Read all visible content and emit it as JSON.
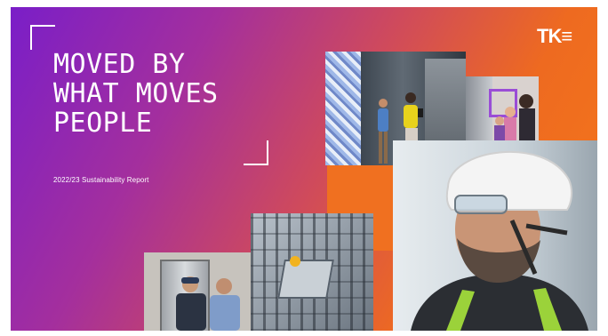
{
  "cover": {
    "headline": [
      "MOVED BY",
      "WHAT MOVES",
      "PEOPLE"
    ],
    "subtitle": "2022/23 Sustainability Report",
    "logo": "TK≡"
  },
  "colors": {
    "gradient_start": "#7a1ec8",
    "gradient_mid": "#cf4a5c",
    "gradient_end": "#f5781a",
    "orange": "#f07020",
    "text": "#ffffff"
  },
  "images": [
    "office-lobby-photo",
    "family-elevator-photo",
    "elevator-technicians-photo",
    "elevator-shaft-photo",
    "worker-with-hardhat-photo"
  ]
}
